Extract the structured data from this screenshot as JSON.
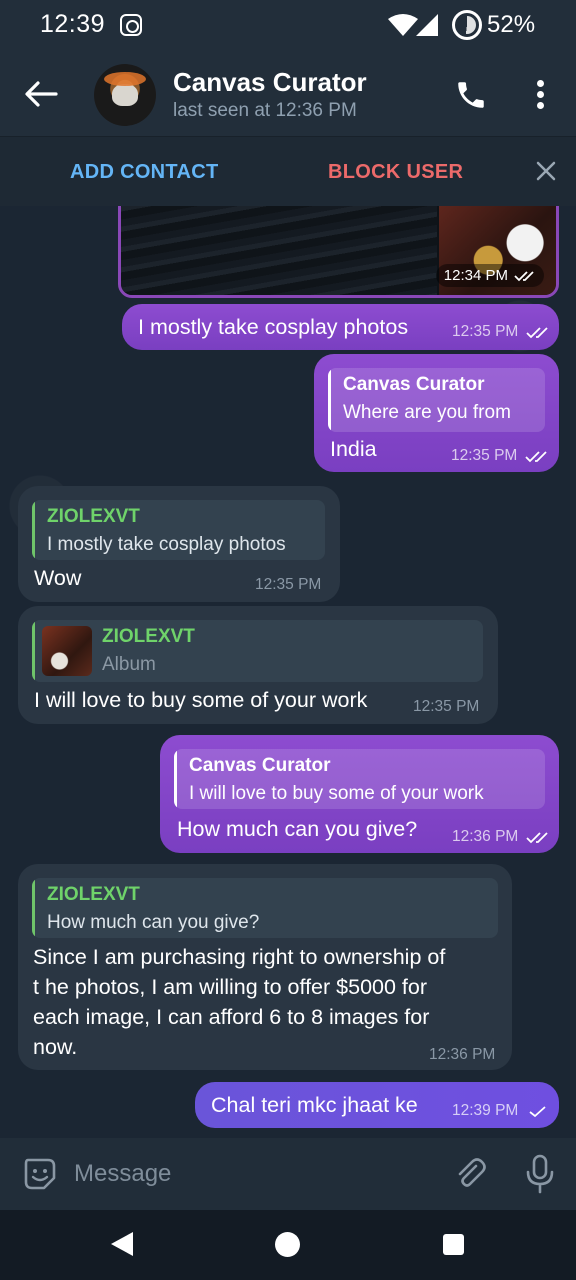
{
  "status_bar": {
    "time": "12:39",
    "battery_percent": "52%",
    "battery_level": 0.52
  },
  "header": {
    "title": "Canvas Curator",
    "subtitle": "last seen at 12:36 PM"
  },
  "actions": {
    "add_contact": "ADD CONTACT",
    "block_user": "BLOCK USER"
  },
  "messages": [
    {
      "time": "12:34 PM"
    },
    {
      "text": "I mostly take cosplay photos",
      "time": "12:35 PM"
    },
    {
      "reply_name": "Canvas Curator",
      "reply_text": "Where are you from",
      "text": "India",
      "time": "12:35 PM"
    },
    {
      "reply_name": "ZIOLEXVT",
      "reply_text": "I mostly take cosplay photos",
      "text": "Wow",
      "time": "12:35 PM"
    },
    {
      "reply_name": "ZIOLEXVT",
      "reply_text": "Album",
      "text": "I will love to buy some of your work",
      "time": "12:35 PM"
    },
    {
      "reply_name": "Canvas Curator",
      "reply_text": "I will love to buy some of your work",
      "text": "How much can you give?",
      "time": "12:36 PM"
    },
    {
      "reply_name": "ZIOLEXVT",
      "reply_text": "How much can you give?",
      "lines": [
        "Since I am purchasing right to ownership of",
        "t he photos, I am willing to offer $5000 for",
        "each image, I can afford 6 to 8 images for",
        "now."
      ],
      "time": "12:36 PM"
    },
    {
      "text": "Chal teri mkc jhaat ke",
      "time": "12:39 PM"
    }
  ],
  "input": {
    "placeholder": "Message"
  },
  "colors": {
    "outgoing_bubble": "#8d4cd0",
    "outgoing_bubble_latest": "#6a55d9",
    "incoming_bubble": "#2a3643",
    "reply_name_in": "#6fd36a",
    "add_contact": "#64b5f6",
    "block_user": "#ec6a6a"
  }
}
